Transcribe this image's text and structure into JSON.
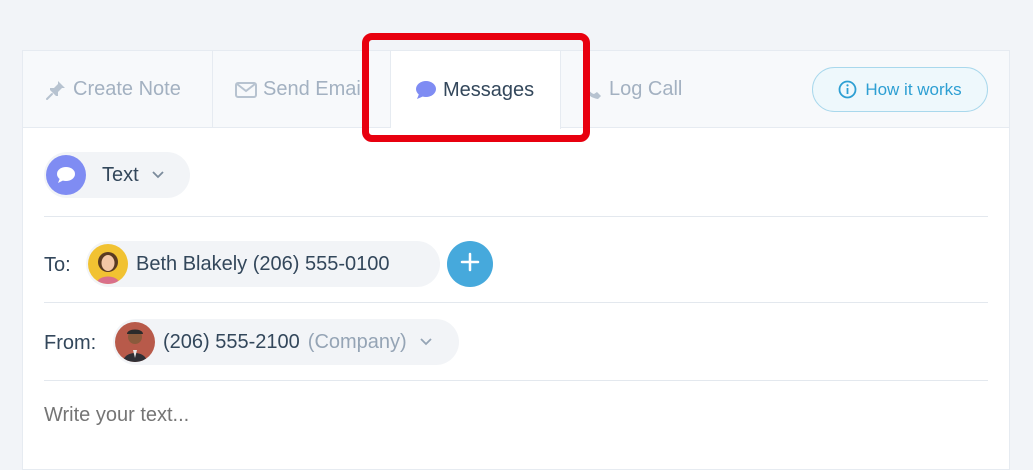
{
  "tabs": {
    "create_note": "Create Note",
    "send_email": "Send Email",
    "messages": "Messages",
    "log_call": "Log Call"
  },
  "how_it_works": "How it works",
  "message_type": {
    "label": "Text"
  },
  "to": {
    "label": "To:",
    "recipient": "Beth Blakely (206) 555-0100"
  },
  "from": {
    "label": "From:",
    "number": "(206) 555-2100",
    "note": "(Company)"
  },
  "compose": {
    "placeholder": "Write your text..."
  },
  "colors": {
    "accent": "#46a9dc",
    "message_icon": "#7f8cf3",
    "highlight": "#e8000f"
  },
  "icons": [
    "pin-icon",
    "envelope-icon",
    "chat-bubble-icon",
    "phone-icon",
    "info-icon",
    "chevron-down-icon",
    "plus-icon"
  ]
}
